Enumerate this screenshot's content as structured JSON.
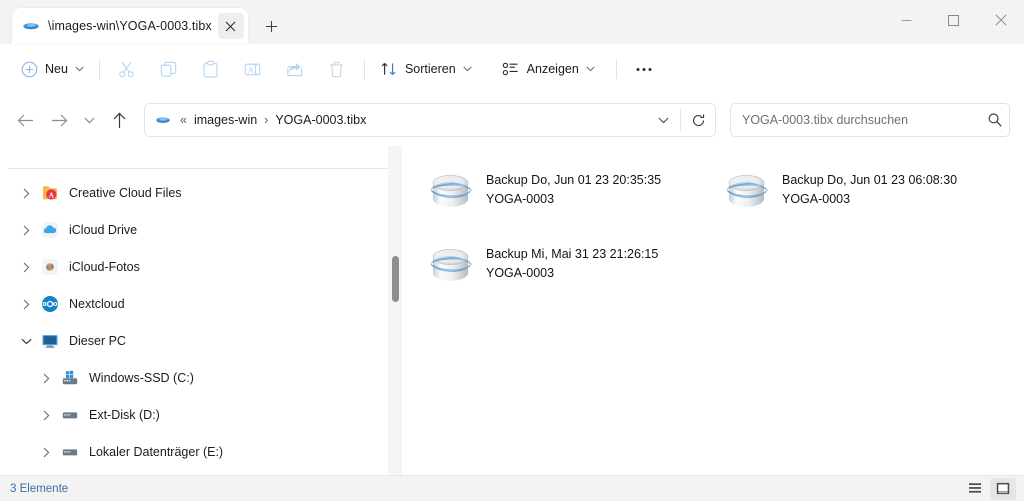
{
  "window": {
    "tab": {
      "title": "\\images-win\\YOGA-0003.tibx",
      "icon": "backup-archive-icon",
      "close_label": "×"
    },
    "new_tab_label": "+",
    "controls": {
      "minimize": "minimize-icon",
      "maximize": "maximize-icon",
      "close": "close-icon"
    }
  },
  "toolbar": {
    "new_label": "Neu",
    "buttons": [
      {
        "name": "cut",
        "icon": "scissors-icon",
        "disabled": true
      },
      {
        "name": "copy",
        "icon": "copy-icon",
        "disabled": true
      },
      {
        "name": "paste",
        "icon": "paste-icon",
        "disabled": true
      },
      {
        "name": "rename",
        "icon": "rename-icon",
        "disabled": true
      },
      {
        "name": "share",
        "icon": "share-icon",
        "disabled": true
      },
      {
        "name": "delete",
        "icon": "trash-icon",
        "disabled": true
      }
    ],
    "sort_label": "Sortieren",
    "view_label": "Anzeigen",
    "more_label": "•••"
  },
  "address": {
    "back_icon": "arrow-left-icon",
    "forward_icon": "arrow-right-icon",
    "recent_icon": "chevron-down-icon",
    "up_icon": "arrow-up-icon",
    "path_icon": "backup-archive-icon",
    "overflow": "«",
    "crumbs": [
      "images-win",
      "YOGA-0003.tibx"
    ],
    "separator": "›",
    "dropdown_icon": "chevron-down-icon",
    "refresh_icon": "refresh-icon"
  },
  "search": {
    "placeholder": "YOGA-0003.tibx durchsuchen",
    "icon": "search-icon"
  },
  "sidebar": {
    "items": [
      {
        "label": "Creative Cloud Files",
        "icon": "creative-cloud-icon",
        "expanded": false,
        "nested": false
      },
      {
        "label": "iCloud Drive",
        "icon": "icloud-drive-icon",
        "expanded": false,
        "nested": false
      },
      {
        "label": "iCloud-Fotos",
        "icon": "icloud-photos-icon",
        "expanded": false,
        "nested": false
      },
      {
        "label": "Nextcloud",
        "icon": "nextcloud-icon",
        "expanded": false,
        "nested": false
      },
      {
        "label": "Dieser PC",
        "icon": "this-pc-icon",
        "expanded": true,
        "nested": false
      },
      {
        "label": "Windows-SSD (C:)",
        "icon": "windows-drive-icon",
        "expanded": false,
        "nested": true
      },
      {
        "label": "Ext-Disk (D:)",
        "icon": "drive-icon",
        "expanded": false,
        "nested": true
      },
      {
        "label": "Lokaler Datenträger (E:)",
        "icon": "drive-icon",
        "expanded": false,
        "nested": true
      }
    ]
  },
  "content": {
    "files": [
      {
        "line1": "Backup Do, Jun 01 23 20:35:35",
        "line2": "YOGA-0003",
        "icon": "backup-disk-icon"
      },
      {
        "line1": "Backup Do, Jun 01 23 06:08:30",
        "line2": "YOGA-0003",
        "icon": "backup-disk-icon"
      },
      {
        "line1": "Backup Mi, Mai 31 23 21:26:15",
        "line2": "YOGA-0003",
        "icon": "backup-disk-icon"
      }
    ]
  },
  "statusbar": {
    "item_count": "3 Elemente",
    "views": [
      {
        "name": "details-view",
        "icon": "list-lines-icon",
        "active": false
      },
      {
        "name": "large-icons-view",
        "icon": "tile-icon",
        "active": true
      }
    ]
  },
  "colors": {
    "accent": "#3b6ea5",
    "tab_bg": "#ffffff",
    "window_bg": "#f3f3f3",
    "text": "#1b1b1b"
  }
}
